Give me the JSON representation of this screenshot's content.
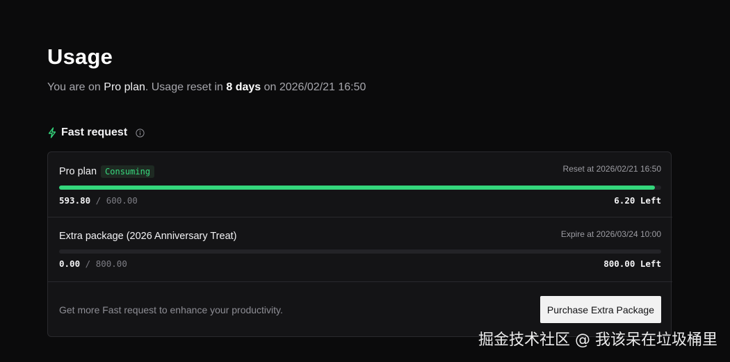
{
  "page": {
    "title": "Usage",
    "subtitle": {
      "prefix": "You are on ",
      "plan": "Pro plan",
      "mid": ". Usage reset in ",
      "days": "8 days",
      "suffix": " on 2026/02/21 16:50"
    }
  },
  "fast_request": {
    "heading": "Fast request",
    "icons": [
      "bolt-icon",
      "info-icon"
    ],
    "accent_color": "#34d67c",
    "plans": [
      {
        "name": "Pro plan",
        "badge": "Consuming",
        "meta": "Reset at 2026/02/21 16:50",
        "used": "593.80",
        "separator": " / ",
        "total": "600.00",
        "left": "6.20 Left",
        "progress_fraction": 0.9897
      },
      {
        "name": "Extra package (2026 Anniversary Treat)",
        "meta": "Expire at 2026/03/24 10:00",
        "used": "0.00",
        "separator": " / ",
        "total": "800.00",
        "left": "800.00 Left",
        "progress_fraction": 0
      }
    ],
    "promo_text": "Get more Fast request to enhance your productivity.",
    "purchase_label": "Purchase Extra Package"
  },
  "watermark": "掘金技术社区 @ 我该呆在垃圾桶里"
}
